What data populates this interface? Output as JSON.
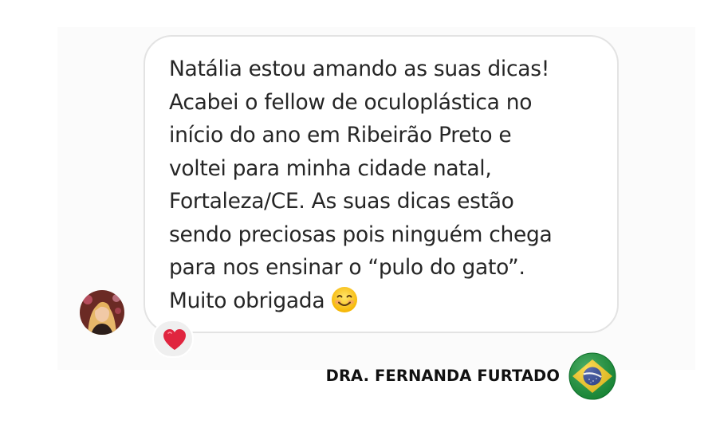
{
  "message": {
    "lines": [
      "Natália estou amando as suas dicas!",
      "Acabei o fellow de oculoplástica no",
      "início do ano em Ribeirão Preto e",
      "voltei para minha cidade natal,",
      "Fortaleza/CE. As suas dicas estão",
      "sendo preciosas pois ninguém chega",
      "para nos ensinar o “pulo do gato”.",
      "Muito obrigada"
    ],
    "emoji": "smiling-face-icon"
  },
  "reaction": {
    "icon": "heart-icon",
    "color": "#e0253f"
  },
  "sender": {
    "avatar": "avatar",
    "name": "DRA. FERNANDA FURTADO",
    "flag": "brazil-flag-icon"
  }
}
